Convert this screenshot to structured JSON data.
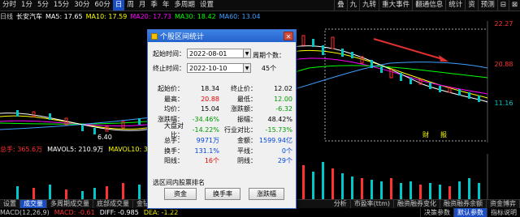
{
  "toolbar": {
    "items": [
      "分时",
      "1分",
      "5分",
      "15分",
      "30分",
      "60分",
      "日",
      "周",
      "月",
      "季",
      "年",
      "多周期",
      "设置"
    ],
    "active_index": 6,
    "right_items": [
      "叠",
      "九",
      "九转",
      "重大事件",
      "翻通信息",
      "统计",
      "资",
      "预测",
      "⊟",
      "⊠"
    ]
  },
  "info": {
    "stock_label": "日线",
    "stock_name": "长安汽车",
    "ma5": "MA5: 17.65",
    "ma10": "MA10: 17.59",
    "ma20": "MA20: 17.73",
    "ma30": "MA30: 18.42",
    "ma60": "MA60: 13.04"
  },
  "price_axis": {
    "top": "22.27",
    "upper": "20.88",
    "lower": "11.16"
  },
  "chart_labels": {
    "low_mark": "6.40",
    "right_label_1": "财",
    "right_label_2": "报"
  },
  "volume_bar": {
    "vol_label": "总手: 365.6万",
    "mavol5": "MAVOL5: 210.9万",
    "mavol10": "MAVOL10: 359"
  },
  "tabs": [
    "设置",
    "成交量",
    "多周期成交量",
    "底部成交量",
    "金钻",
    "分析",
    "市盈率(ttm)",
    "融资融券变化",
    "融资融券余额",
    "资金博弈"
  ],
  "bottom": {
    "macd": "MACD(12,26,9)",
    "macd_val": "MACD: -0.61",
    "diff": "DIFF: -0.985",
    "dea": "DEA: -1.22",
    "right_buttons": [
      "决策参数",
      "默认参数",
      "指标说明"
    ]
  },
  "dialog": {
    "title": "个股区间统计",
    "start_label": "起始时间：",
    "start_value": "2022-08-01",
    "end_label": "终止时间：",
    "end_value": "2022-10-10",
    "period_label": "周期个数：",
    "period_value": "45个",
    "stats": [
      {
        "l": "起始价：",
        "v": "18.34",
        "vc": "",
        "l2": "终止价：",
        "v2": "12.02",
        "v2c": ""
      },
      {
        "l": "最高：",
        "v": "20.88",
        "vc": "red",
        "l2": "最低：",
        "v2": "12.00",
        "v2c": "green"
      },
      {
        "l": "均价：",
        "v": "15.04",
        "vc": "",
        "l2": "涨跌额：",
        "v2": "-6.32",
        "v2c": "green"
      },
      {
        "l": "涨跌幅：",
        "v": "-34.46%",
        "vc": "green",
        "l2": "振幅：",
        "v2": "48.42%",
        "v2c": ""
      },
      {
        "l": "大盘对比：",
        "v": "-14.22%",
        "vc": "green",
        "l2": "行业对比：",
        "v2": "-15.73%",
        "v2c": "green"
      },
      {
        "l": "总手：",
        "v": "9971万",
        "vc": "blue",
        "l2": "金额：",
        "v2": "1599.94亿",
        "v2c": "blue"
      },
      {
        "l": "换手：",
        "v": "131.1%",
        "vc": "blue",
        "l2": "平线：",
        "v2": "0个",
        "v2c": "blue"
      },
      {
        "l": "阳线：",
        "v": "16个",
        "vc": "red",
        "l2": "阴线：",
        "v2": "29个",
        "v2c": "blue"
      }
    ],
    "section_label": "选区间内股票排名",
    "buttons": [
      "资金",
      "换手率",
      "涨跌幅"
    ]
  },
  "colors": {
    "up": "#ff3232",
    "down": "#00c8c8",
    "ma5": "#ffffff",
    "ma10": "#ffff00",
    "ma20": "#ff00ff",
    "ma30": "#00ff00",
    "ma60": "#3fa0ff",
    "accent": "#1a4cc2"
  }
}
